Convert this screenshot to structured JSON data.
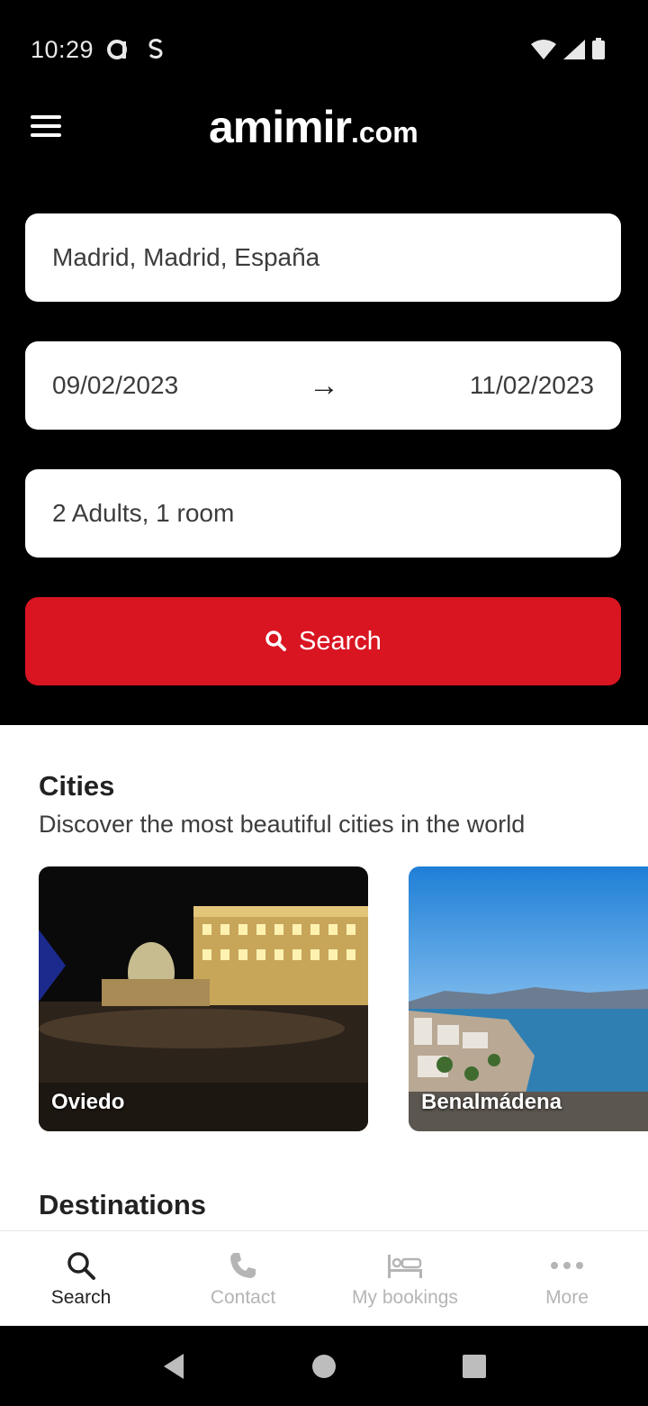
{
  "status_bar": {
    "time": "10:29"
  },
  "header": {
    "logo_main": "amimir",
    "logo_domain": ".com"
  },
  "search_form": {
    "destination": "Madrid, Madrid, España",
    "check_in": "09/02/2023",
    "check_out": "11/02/2023",
    "guests": "2 Adults, 1 room",
    "search_label": "Search"
  },
  "cities": {
    "title": "Cities",
    "subtitle": "Discover the most beautiful cities in the world",
    "items": [
      {
        "name": "Oviedo"
      },
      {
        "name": "Benalmádena"
      }
    ]
  },
  "destinations": {
    "title": "Destinations"
  },
  "bottom_nav": [
    {
      "label": "Search",
      "icon": "search-icon",
      "active": true
    },
    {
      "label": "Contact",
      "icon": "phone-icon",
      "active": false
    },
    {
      "label": "My bookings",
      "icon": "bed-icon",
      "active": false
    },
    {
      "label": "More",
      "icon": "more-icon",
      "active": false
    }
  ],
  "colors": {
    "accent": "#d91522",
    "header_bg": "#000000"
  }
}
